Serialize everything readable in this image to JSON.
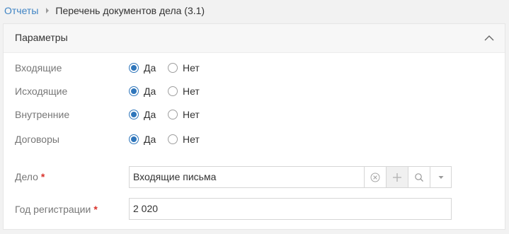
{
  "breadcrumb": {
    "root": "Отчеты",
    "current": "Перечень документов дела (3.1)"
  },
  "panel": {
    "title": "Параметры",
    "collapse_icon": "chevron-up-icon"
  },
  "radio_groups": [
    {
      "label": "Входящие",
      "options": [
        "Да",
        "Нет"
      ],
      "selected": "Да"
    },
    {
      "label": "Исходящие",
      "options": [
        "Да",
        "Нет"
      ],
      "selected": "Да"
    },
    {
      "label": "Внутренние",
      "options": [
        "Да",
        "Нет"
      ],
      "selected": "Да"
    },
    {
      "label": "Договоры",
      "options": [
        "Да",
        "Нет"
      ],
      "selected": "Да"
    }
  ],
  "fields": {
    "case": {
      "label": "Дело",
      "required_mark": "*",
      "value": "Входящие письма",
      "icons": [
        "clear-icon",
        "plus-icon",
        "search-icon",
        "dropdown-arrow-icon"
      ]
    },
    "year": {
      "label": "Год регистрации",
      "required_mark": "*",
      "value": "2 020"
    }
  },
  "colors": {
    "accent": "#2f76bb",
    "link": "#3f84c4",
    "required": "#d9322b",
    "label": "#777777",
    "page_background": "#f2f2f2"
  }
}
